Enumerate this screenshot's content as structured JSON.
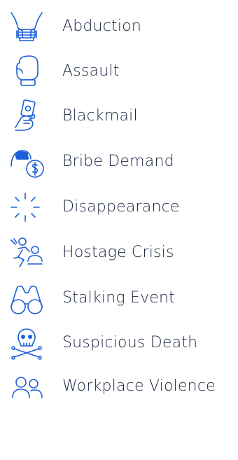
{
  "items": [
    {
      "label": "Abduction",
      "icon": "hands-icon"
    },
    {
      "label": "Assault",
      "icon": "fist-icon"
    },
    {
      "label": "Blackmail",
      "icon": "hand-money-icon"
    },
    {
      "label": "Bribe Demand",
      "icon": "masked-dollar-icon"
    },
    {
      "label": "Disappearance",
      "icon": "burst-icon"
    },
    {
      "label": "Hostage Crisis",
      "icon": "hostage-icon"
    },
    {
      "label": "Stalking Event",
      "icon": "binoculars-icon"
    },
    {
      "label": "Suspicious Death",
      "icon": "skull-crossbones-icon"
    },
    {
      "label": "Workplace Violence",
      "icon": "people-icon"
    }
  ],
  "colors": {
    "icon": "#1a5fd6",
    "text": "#1b2540"
  }
}
